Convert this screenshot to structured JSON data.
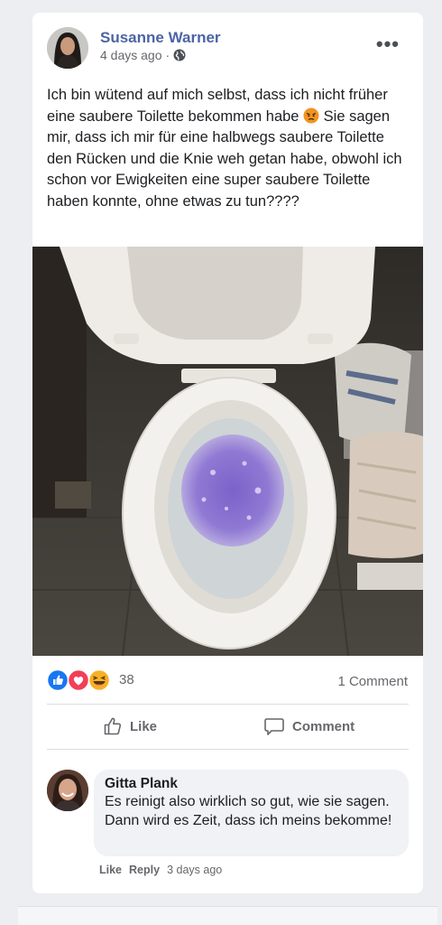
{
  "post": {
    "author": "Susanne Warner",
    "timestamp": "4 days ago",
    "separator": "·",
    "more_label": "•••",
    "text": "Ich bin wütend auf mich selbst, dass ich nicht früher eine saubere Toilette bekommen habe",
    "text_after_emoji": " Sie sagen mir, dass ich mir für eine halbwegs saubere Toilette den Rücken und die Knie weh getan habe, obwohl ich schon vor Ewigkeiten eine super saubere Toilette haben konnte, ohne etwas zu tun????",
    "text_emoji_icon": "angry-face-icon",
    "photo_icon": "toilet-photo"
  },
  "reactions": {
    "icons": [
      "like-icon",
      "love-icon",
      "haha-icon"
    ],
    "count": "38",
    "comments_count": "1 Comment"
  },
  "actions": {
    "like_label": "Like",
    "comment_label": "Comment"
  },
  "comment": {
    "author": "Gitta Plank",
    "text": "Es reinigt also wirklich so gut, wie sie sagen. Dann wird es Zeit, dass ich meins bekomme!",
    "like_label": "Like",
    "reply_label": "Reply",
    "timestamp": "3 days ago"
  },
  "colors": {
    "brand_blue": "#4c64a5",
    "like_blue": "#1877f2",
    "love_red": "#f33e58",
    "haha_yellow": "#f7b125",
    "page_background": "#edeef2"
  }
}
